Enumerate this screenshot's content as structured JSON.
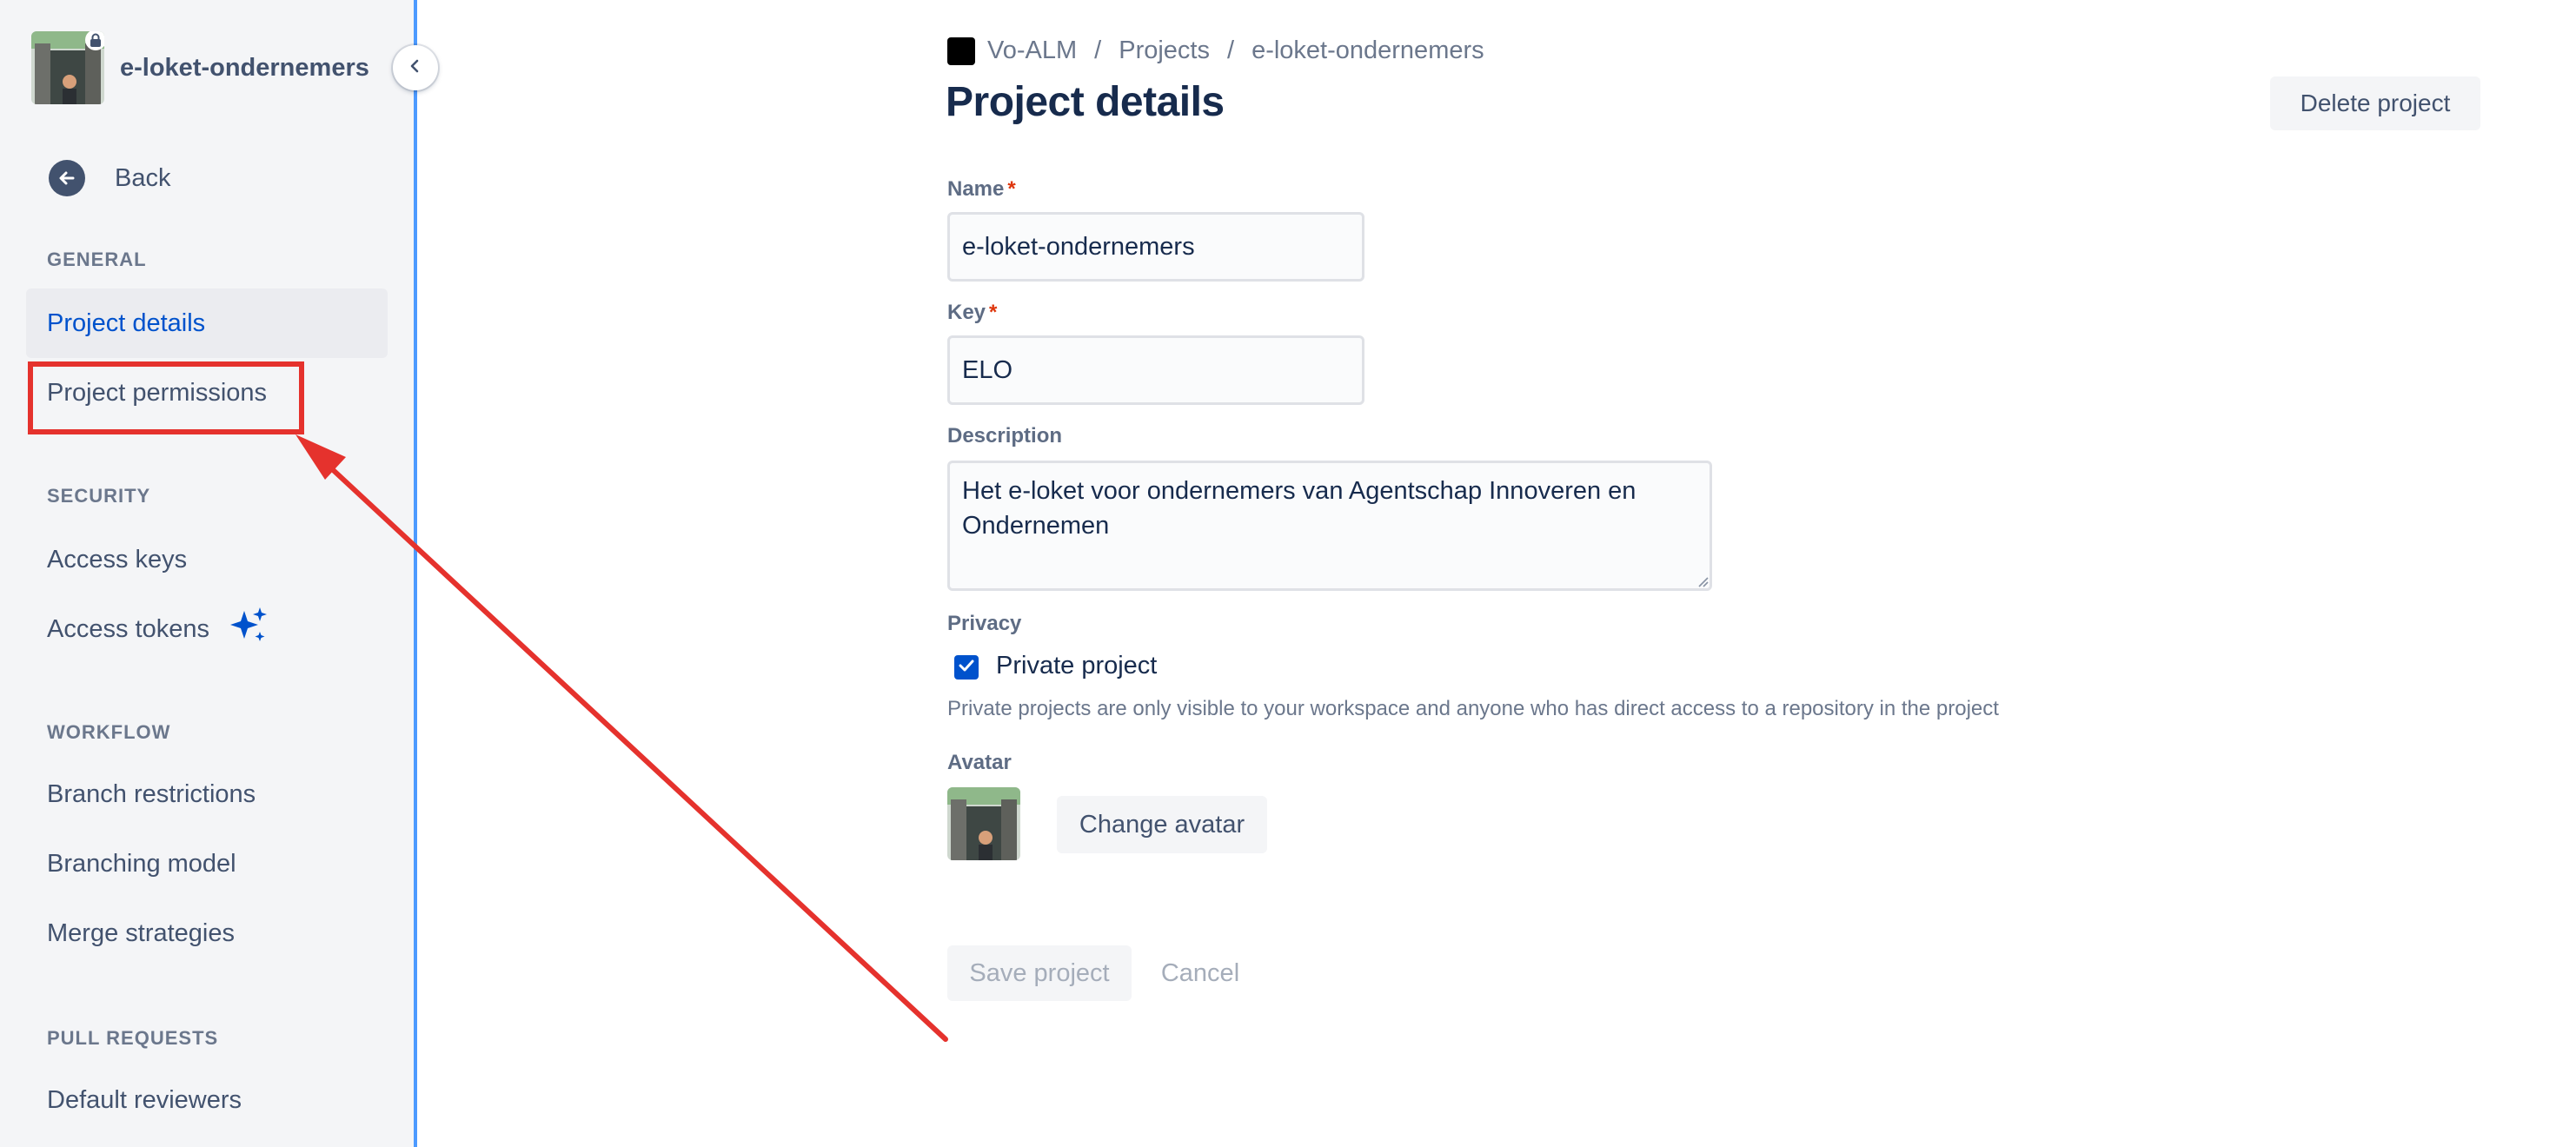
{
  "sidebar": {
    "project_name": "e-loket-ondernemers",
    "back_label": "Back",
    "sections": {
      "general": "GENERAL",
      "security": "SECURITY",
      "workflow": "WORKFLOW",
      "pull_requests": "PULL REQUESTS"
    },
    "items": {
      "project_details": "Project details",
      "project_permissions": "Project permissions",
      "access_keys": "Access keys",
      "access_tokens": "Access tokens",
      "branch_restrictions": "Branch restrictions",
      "branching_model": "Branching model",
      "merge_strategies": "Merge strategies",
      "default_reviewers": "Default reviewers"
    },
    "selected_item": "Project details"
  },
  "breadcrumb": {
    "workspace": "Vo-ALM",
    "projects": "Projects",
    "project": "e-loket-ondernemers",
    "separator": "/"
  },
  "page": {
    "title": "Project details",
    "delete_label": "Delete project"
  },
  "form": {
    "name_label": "Name",
    "name_value": "e-loket-ondernemers",
    "key_label": "Key",
    "key_value": "ELO",
    "required_marker": "*",
    "description_label": "Description",
    "description_value": "Het e-loket voor ondernemers van Agentschap Innoveren en Ondernemen",
    "privacy_label": "Privacy",
    "private_label": "Private project",
    "private_checked": true,
    "private_helper": "Private projects are only visible to your workspace and anyone who has direct access to a repository in the project",
    "avatar_label": "Avatar",
    "change_avatar_label": "Change avatar",
    "save_label": "Save project",
    "cancel_label": "Cancel"
  },
  "colors": {
    "accent": "#0052cc",
    "annotation": "#e5322d",
    "sidebar_bg": "#f4f5f7",
    "sidebar_border": "#4c9aff"
  },
  "icons": {
    "collapse": "chevron-left-icon",
    "back": "arrow-left-circle-icon",
    "sparkle": "sparkle-icon",
    "lock": "lock-icon",
    "checkbox": "check-icon"
  }
}
